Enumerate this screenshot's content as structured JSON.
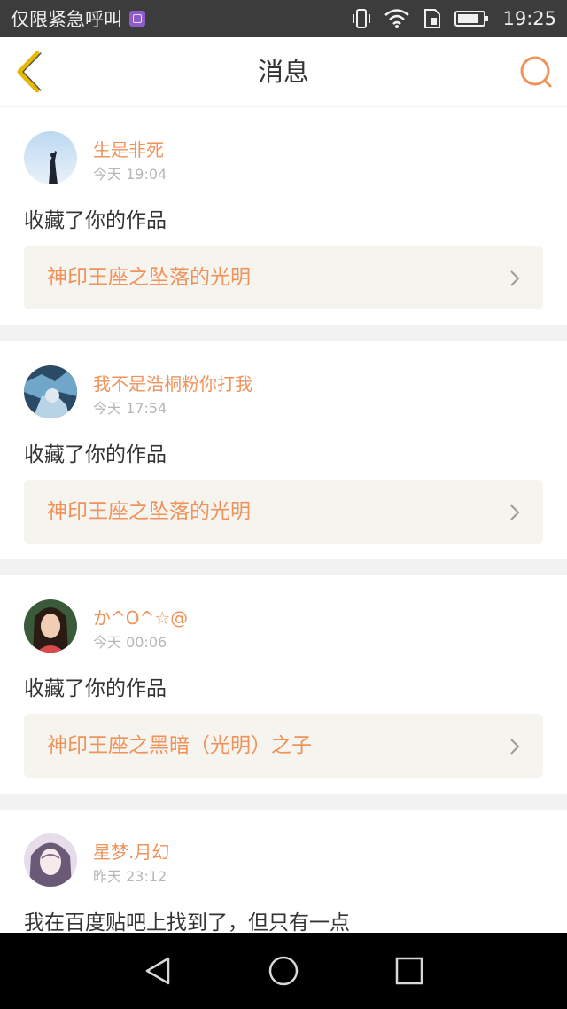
{
  "status_bar": {
    "carrier": "仅限紧急呼叫",
    "time": "19:25",
    "icons": [
      "gallery-notification-icon",
      "vibrate-icon",
      "wifi-icon",
      "sim-icon",
      "battery-icon"
    ]
  },
  "header": {
    "title": "消息",
    "back_icon": "chevron-left-icon",
    "search_icon": "search-icon",
    "accent_color": "#f0925a",
    "back_color": "#e6b800"
  },
  "messages": [
    {
      "username": "生是非死",
      "time": "今天 19:04",
      "action": "收藏了你的作品",
      "work_title": "神印王座之坠落的光明"
    },
    {
      "username": "我不是浩桐粉你打我",
      "time": "今天 17:54",
      "action": "收藏了你的作品",
      "work_title": "神印王座之坠落的光明"
    },
    {
      "username": "か^O^☆@",
      "time": "今天 00:06",
      "action": "收藏了你的作品",
      "work_title": "神印王座之黑暗（光明）之子"
    },
    {
      "username": "星梦.月幻",
      "time": "昨天 23:12",
      "action": "我在百度贴吧上找到了，但只有一点"
    }
  ],
  "system_nav": {
    "icons": [
      "back-triangle-icon",
      "home-circle-icon",
      "recents-square-icon"
    ]
  }
}
